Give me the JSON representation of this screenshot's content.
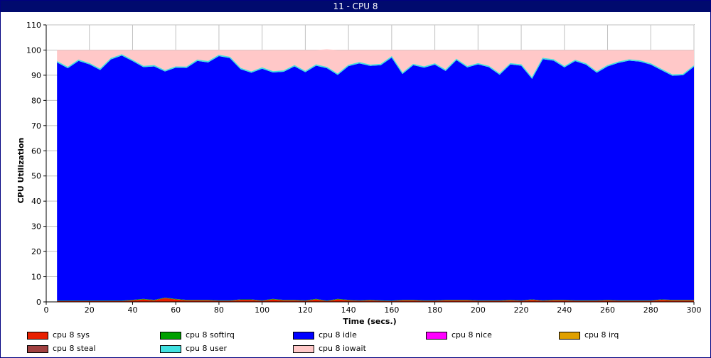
{
  "window": {
    "title": "11 - CPU 8"
  },
  "chart_data": {
    "type": "area",
    "title": "",
    "xlabel": "Time (secs.)",
    "ylabel": "CPU Utilization",
    "xlim": [
      0,
      300
    ],
    "ylim": [
      0,
      110
    ],
    "x_ticks": [
      0,
      20,
      40,
      60,
      80,
      100,
      120,
      140,
      160,
      180,
      200,
      220,
      240,
      260,
      280,
      300
    ],
    "y_ticks": [
      0,
      10,
      20,
      30,
      40,
      50,
      60,
      70,
      80,
      90,
      100,
      110
    ],
    "grid": true,
    "stacked": true,
    "x": [
      5,
      10,
      15,
      20,
      25,
      30,
      35,
      40,
      45,
      50,
      55,
      60,
      65,
      70,
      75,
      80,
      85,
      90,
      95,
      100,
      105,
      110,
      115,
      120,
      125,
      130,
      135,
      140,
      145,
      150,
      155,
      160,
      165,
      170,
      175,
      180,
      185,
      190,
      195,
      200,
      205,
      210,
      215,
      220,
      225,
      230,
      235,
      240,
      245,
      250,
      255,
      260,
      265,
      270,
      275,
      280,
      285,
      290,
      295,
      300
    ],
    "series": [
      {
        "name": "cpu 8 sys",
        "color": "#e82000",
        "values": [
          0.3,
          0.3,
          0.3,
          0.3,
          0.3,
          0.3,
          0.3,
          0.6,
          1.0,
          0.6,
          1.5,
          1.0,
          0.6,
          0.6,
          0.6,
          0.4,
          0.4,
          0.8,
          0.8,
          0.4,
          1.0,
          0.6,
          0.6,
          0.4,
          1.0,
          0.3,
          1.0,
          0.6,
          0.4,
          0.6,
          0.4,
          0.3,
          0.6,
          0.6,
          0.4,
          0.4,
          0.6,
          0.6,
          0.6,
          0.4,
          0.4,
          0.4,
          0.6,
          0.4,
          0.8,
          0.4,
          0.6,
          0.6,
          0.4,
          0.4,
          0.4,
          0.6,
          0.4,
          0.4,
          0.4,
          0.4,
          0.8,
          0.6,
          0.6,
          0.6
        ]
      },
      {
        "name": "cpu 8 softirq",
        "color": "#00a000",
        "values": [
          0.2,
          0.2,
          0.2,
          0.2,
          0.2,
          0.2,
          0.2,
          0.2,
          0.2,
          0.2,
          0.2,
          0.2,
          0.2,
          0.2,
          0.2,
          0.2,
          0.2,
          0.2,
          0.2,
          0.2,
          0.2,
          0.2,
          0.2,
          0.2,
          0.2,
          0.2,
          0.2,
          0.2,
          0.2,
          0.2,
          0.2,
          0.2,
          0.2,
          0.2,
          0.2,
          0.2,
          0.2,
          0.2,
          0.2,
          0.2,
          0.2,
          0.2,
          0.2,
          0.2,
          0.2,
          0.2,
          0.2,
          0.2,
          0.2,
          0.2,
          0.2,
          0.2,
          0.2,
          0.2,
          0.2,
          0.2,
          0.2,
          0.2,
          0.2,
          0.2
        ]
      },
      {
        "name": "cpu 8 idle",
        "color": "#0000ff",
        "values": [
          94.6,
          92.3,
          95.2,
          93.8,
          91.6,
          95.8,
          97.3,
          94.8,
          92.0,
          92.7,
          89.8,
          91.8,
          92.1,
          94.9,
          94.3,
          97.0,
          96.2,
          91.4,
          90.0,
          92.0,
          89.9,
          90.6,
          92.7,
          90.6,
          92.6,
          92.3,
          88.9,
          92.8,
          94.1,
          92.9,
          93.4,
          96.5,
          89.7,
          93.2,
          92.4,
          93.6,
          90.9,
          95.2,
          92.3,
          93.7,
          92.6,
          89.6,
          93.5,
          93.2,
          87.6,
          95.8,
          95.0,
          92.3,
          95.0,
          93.6,
          90.4,
          92.7,
          94.3,
          95.2,
          94.8,
          93.6,
          91.0,
          89.0,
          89.2,
          92.6
        ]
      },
      {
        "name": "cpu 8 nice",
        "color": "#ff00ff",
        "values": [
          0,
          0,
          0,
          0,
          0,
          0,
          0,
          0,
          0,
          0,
          0,
          0,
          0,
          0,
          0,
          0,
          0,
          0,
          0,
          0,
          0,
          0,
          0,
          0,
          0,
          0,
          0,
          0,
          0,
          0,
          0,
          0,
          0,
          0,
          0,
          0,
          0,
          0,
          0,
          0,
          0,
          0,
          0,
          0,
          0,
          0,
          0,
          0,
          0,
          0,
          0,
          0,
          0,
          0,
          0,
          0,
          0,
          0,
          0,
          0
        ]
      },
      {
        "name": "cpu 8 irq",
        "color": "#e0a000",
        "values": [
          0,
          0,
          0,
          0,
          0,
          0,
          0,
          0,
          0,
          0,
          0,
          0,
          0,
          0,
          0,
          0,
          0,
          0,
          0,
          0,
          0,
          0,
          0,
          0,
          0,
          0,
          0,
          0,
          0,
          0,
          0,
          0,
          0,
          0,
          0,
          0,
          0,
          0,
          0,
          0,
          0,
          0,
          0,
          0,
          0,
          0,
          0,
          0,
          0,
          0,
          0,
          0,
          0,
          0,
          0,
          0,
          0,
          0,
          0,
          0
        ]
      },
      {
        "name": "cpu 8 steal",
        "color": "#a04040",
        "values": [
          0,
          0,
          0,
          0,
          0,
          0,
          0,
          0,
          0,
          0,
          0,
          0,
          0,
          0,
          0,
          0,
          0,
          0,
          0,
          0,
          0,
          0,
          0,
          0,
          0,
          0,
          0,
          0,
          0,
          0,
          0,
          0,
          0,
          0,
          0,
          0,
          0,
          0,
          0,
          0,
          0,
          0,
          0,
          0,
          0,
          0,
          0,
          0,
          0,
          0,
          0,
          0,
          0,
          0,
          0,
          0,
          0,
          0,
          0,
          0
        ]
      },
      {
        "name": "cpu 8 user",
        "color": "#40e0e0",
        "values": [
          0.3,
          0.3,
          0.3,
          0.3,
          0.3,
          0.3,
          0.3,
          0.3,
          0.3,
          0.3,
          0.3,
          0.3,
          0.3,
          0.3,
          0.3,
          0.3,
          0.3,
          0.3,
          0.3,
          0.3,
          0.3,
          0.3,
          0.3,
          0.3,
          0.3,
          0.3,
          0.3,
          0.3,
          0.3,
          0.3,
          0.3,
          0.3,
          0.3,
          0.3,
          0.3,
          0.3,
          0.3,
          0.3,
          0.3,
          0.3,
          0.3,
          0.3,
          0.3,
          0.3,
          0.3,
          0.3,
          0.3,
          0.3,
          0.3,
          0.3,
          0.3,
          0.3,
          0.3,
          0.3,
          0.3,
          0.3,
          0.3,
          0.3,
          0.3,
          0.3
        ]
      },
      {
        "name": "cpu 8 iowait",
        "color": "#ffc8c8",
        "values": [
          4.6,
          6.9,
          4.0,
          5.4,
          7.6,
          3.4,
          1.9,
          4.1,
          6.5,
          6.2,
          8.2,
          6.7,
          6.8,
          4.0,
          4.6,
          2.1,
          2.9,
          7.3,
          8.7,
          7.1,
          8.6,
          8.3,
          6.2,
          8.5,
          5.9,
          7.2,
          9.6,
          6.1,
          5.0,
          6.0,
          5.7,
          2.7,
          9.2,
          5.7,
          6.7,
          5.5,
          8.0,
          3.7,
          6.6,
          5.4,
          6.5,
          9.5,
          5.4,
          5.9,
          11.1,
          3.3,
          3.9,
          6.6,
          4.1,
          5.5,
          8.7,
          6.2,
          4.8,
          3.9,
          4.3,
          5.5,
          7.7,
          9.9,
          9.7,
          6.3
        ]
      }
    ]
  }
}
